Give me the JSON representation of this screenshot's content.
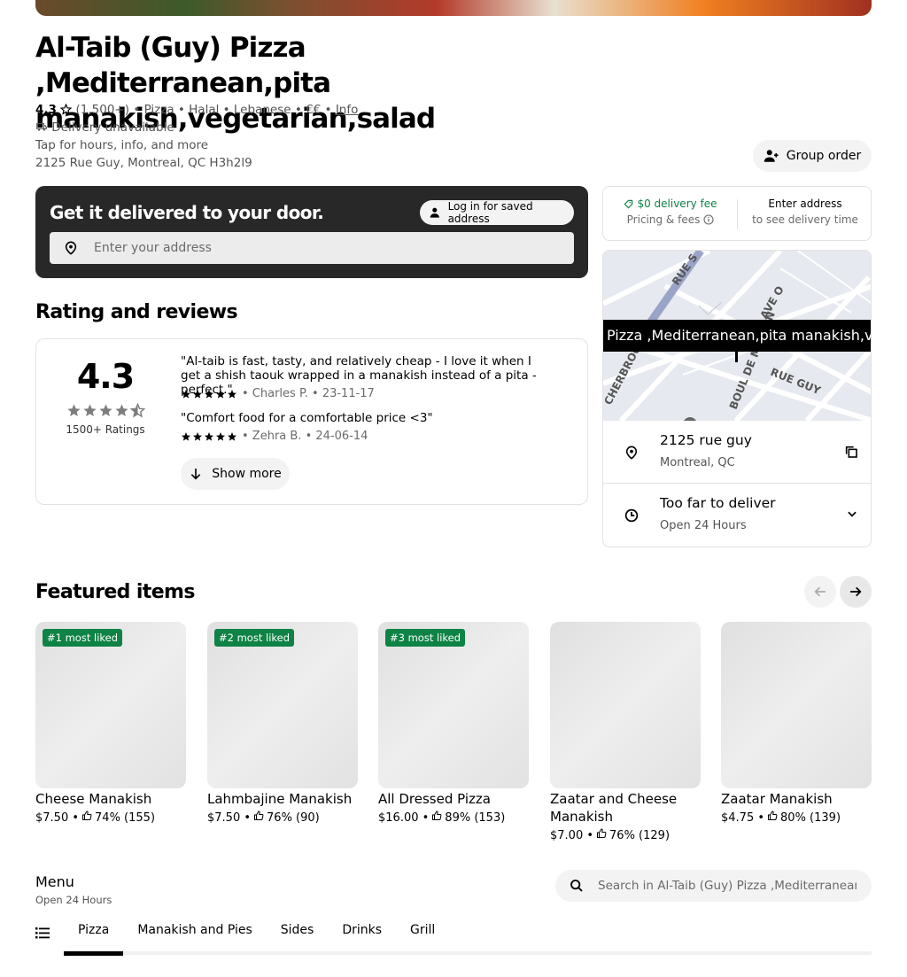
{
  "store": {
    "name": "Al-Taib (Guy) Pizza ,Mediterranean,pita manakish,vegetarian,salad",
    "rating": "4.3",
    "rating_count": "(1,500+)",
    "categories": "• Pizza • Halal • Lebanese • €€ •",
    "info_link": "Info",
    "delivery_status": "Delivery unavailable",
    "tap_hint": "Tap for hours, info, and more",
    "address": "2125 Rue Guy, Montreal, QC H3h2l9"
  },
  "header": {
    "group_order_label": "Group order"
  },
  "delivery_card": {
    "title": "Get it delivered to your door.",
    "login_label": "Log in for saved address",
    "address_placeholder": "Enter your address"
  },
  "reviews": {
    "heading": "Rating and reviews",
    "average": "4.3",
    "stars": 4.5,
    "count_label": "1500+ Ratings",
    "items": [
      {
        "text": "\"Al-taib is fast, tasty, and relatively cheap - I love it when I get a shish taouk wrapped in a manakish instead of a pita - perfect.\"",
        "author": "• Charles P. • 23-11-17"
      },
      {
        "text": "\"Comfort food for a comfortable price <3\"",
        "author": "• Zehra B. • 24-06-14"
      }
    ],
    "show_more_label": "Show more"
  },
  "fees": {
    "delivery_fee": "$0 delivery fee",
    "pricing_label": "Pricing & fees",
    "address_prompt": "Enter address",
    "address_prompt_sub": "to see delivery time"
  },
  "map": {
    "banner": "Pizza ,Mediterranean,pita manakish,vegetarian,salad",
    "street_labels": [
      "RUE S",
      "CHERBROOK",
      "AVE O",
      "BOUL DE MAISON",
      "RUE GUY"
    ],
    "address_line1": "2125 rue guy",
    "address_line2": "Montreal, QC",
    "status": "Too far to deliver",
    "hours": "Open 24 Hours"
  },
  "featured": {
    "heading": "Featured items",
    "items": [
      {
        "badge": "#1 most liked",
        "name": "Cheese Manakish",
        "price": "$7.50 •",
        "likes": "74% (155)"
      },
      {
        "badge": "#2 most liked",
        "name": "Lahmbajine Manakish",
        "price": "$7.50 •",
        "likes": "76% (90)"
      },
      {
        "badge": "#3 most liked",
        "name": "All Dressed Pizza",
        "price": "$16.00 •",
        "likes": "89% (153)"
      },
      {
        "badge": "",
        "name": "Zaatar and Cheese Manakish",
        "price": "$7.00 •",
        "likes": "76% (129)"
      },
      {
        "badge": "",
        "name": "Zaatar Manakish",
        "price": "$4.75 •",
        "likes": "80% (139)"
      }
    ]
  },
  "menu": {
    "heading": "Menu",
    "hours": "Open 24 Hours",
    "search_placeholder": "Search in Al-Taib (Guy) Pizza ,Mediterranean,pita manakish,vegetarian,salad",
    "tabs": [
      "Pizza",
      "Manakish and Pies",
      "Sides",
      "Drinks",
      "Grill"
    ],
    "active_tab": "Pizza"
  },
  "colors": {
    "accent_green": "#0e8345",
    "dark_card": "#282828",
    "pill_bg": "#f3f3f3"
  }
}
